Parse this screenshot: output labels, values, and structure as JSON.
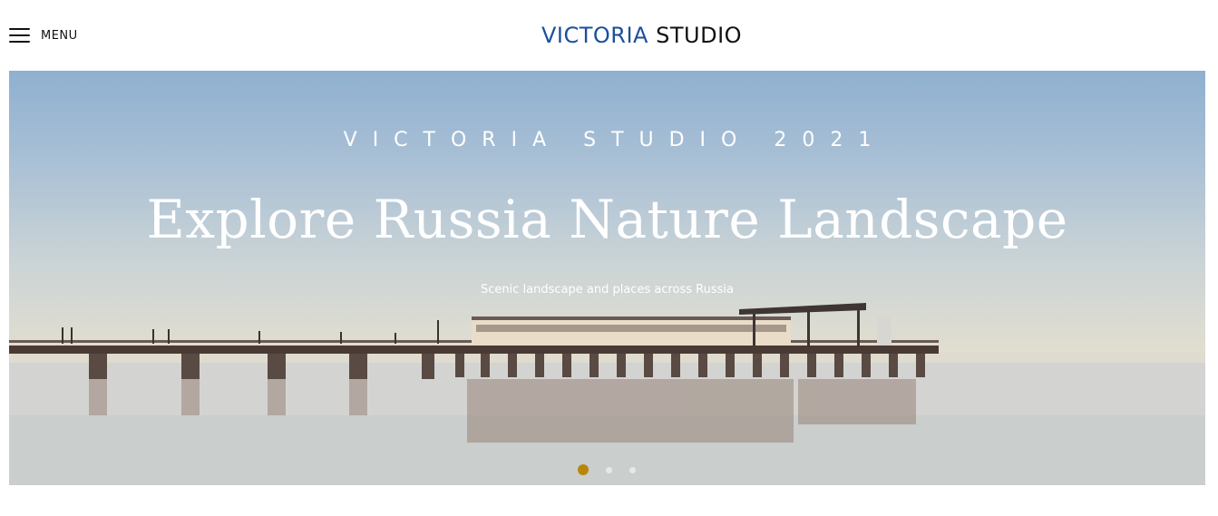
{
  "header": {
    "menu_label": "MENU",
    "logo_part1": "VICTORIA",
    "logo_part2": "STUDIO"
  },
  "hero": {
    "eyebrow": "VICTORIA STUDIO 2021",
    "title": "Explore Russia Nature Landscape",
    "subtitle": "Scenic landscape and places across Russia"
  },
  "slider": {
    "slide_count": 3,
    "active_index": 0
  },
  "colors": {
    "logo_accent": "#1b4f9c",
    "active_dot": "#b8860b"
  }
}
